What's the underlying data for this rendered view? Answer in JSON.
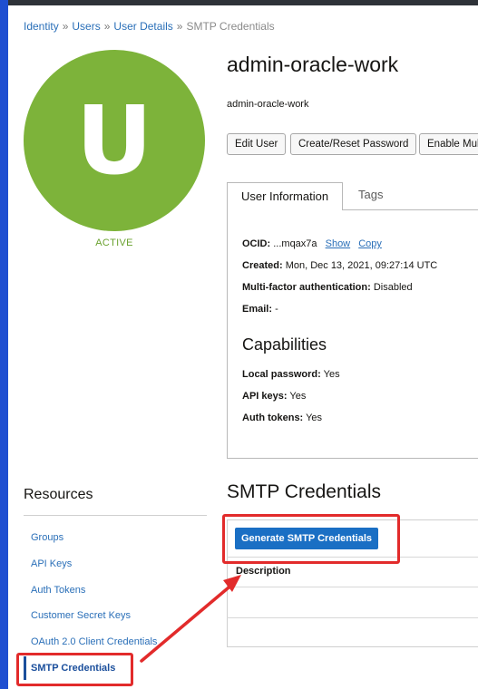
{
  "breadcrumb": {
    "items": [
      "Identity",
      "Users",
      "User Details"
    ],
    "current": "SMTP Credentials",
    "separator": "»"
  },
  "avatar": {
    "letter": "U",
    "color": "#7db33a"
  },
  "status": "ACTIVE",
  "user": {
    "title": "admin-oracle-work",
    "subtitle": "admin-oracle-work"
  },
  "actions": {
    "edit_user": "Edit User",
    "reset_password": "Create/Reset Password",
    "enable_mfa": "Enable Mul"
  },
  "tabs": [
    {
      "label": "User Information",
      "active": true
    },
    {
      "label": "Tags",
      "active": false
    }
  ],
  "info": {
    "ocid_label": "OCID:",
    "ocid_value": "...mqax7a",
    "show": "Show",
    "copy": "Copy",
    "created_label": "Created:",
    "created_value": "Mon, Dec 13, 2021, 09:27:14 UTC",
    "mfa_label": "Multi-factor authentication:",
    "mfa_value": "Disabled",
    "email_label": "Email:",
    "email_value": "-"
  },
  "capabilities": {
    "title": "Capabilities",
    "local_password_label": "Local password:",
    "local_password_value": "Yes",
    "api_keys_label": "API keys:",
    "api_keys_value": "Yes",
    "auth_tokens_label": "Auth tokens:",
    "auth_tokens_value": "Yes"
  },
  "resources": {
    "title": "Resources",
    "items": [
      {
        "label": "Groups"
      },
      {
        "label": "API Keys"
      },
      {
        "label": "Auth Tokens"
      },
      {
        "label": "Customer Secret Keys"
      },
      {
        "label": "OAuth 2.0 Client Credentials"
      },
      {
        "label": "SMTP Credentials",
        "active": true
      }
    ]
  },
  "smtp": {
    "title": "SMTP Credentials",
    "generate_button": "Generate SMTP Credentials",
    "column_description": "Description"
  },
  "colors": {
    "accent": "#1a6fc4",
    "link": "#2a6fb8",
    "active_status": "#6aa22f",
    "highlight": "#e22b2b"
  }
}
